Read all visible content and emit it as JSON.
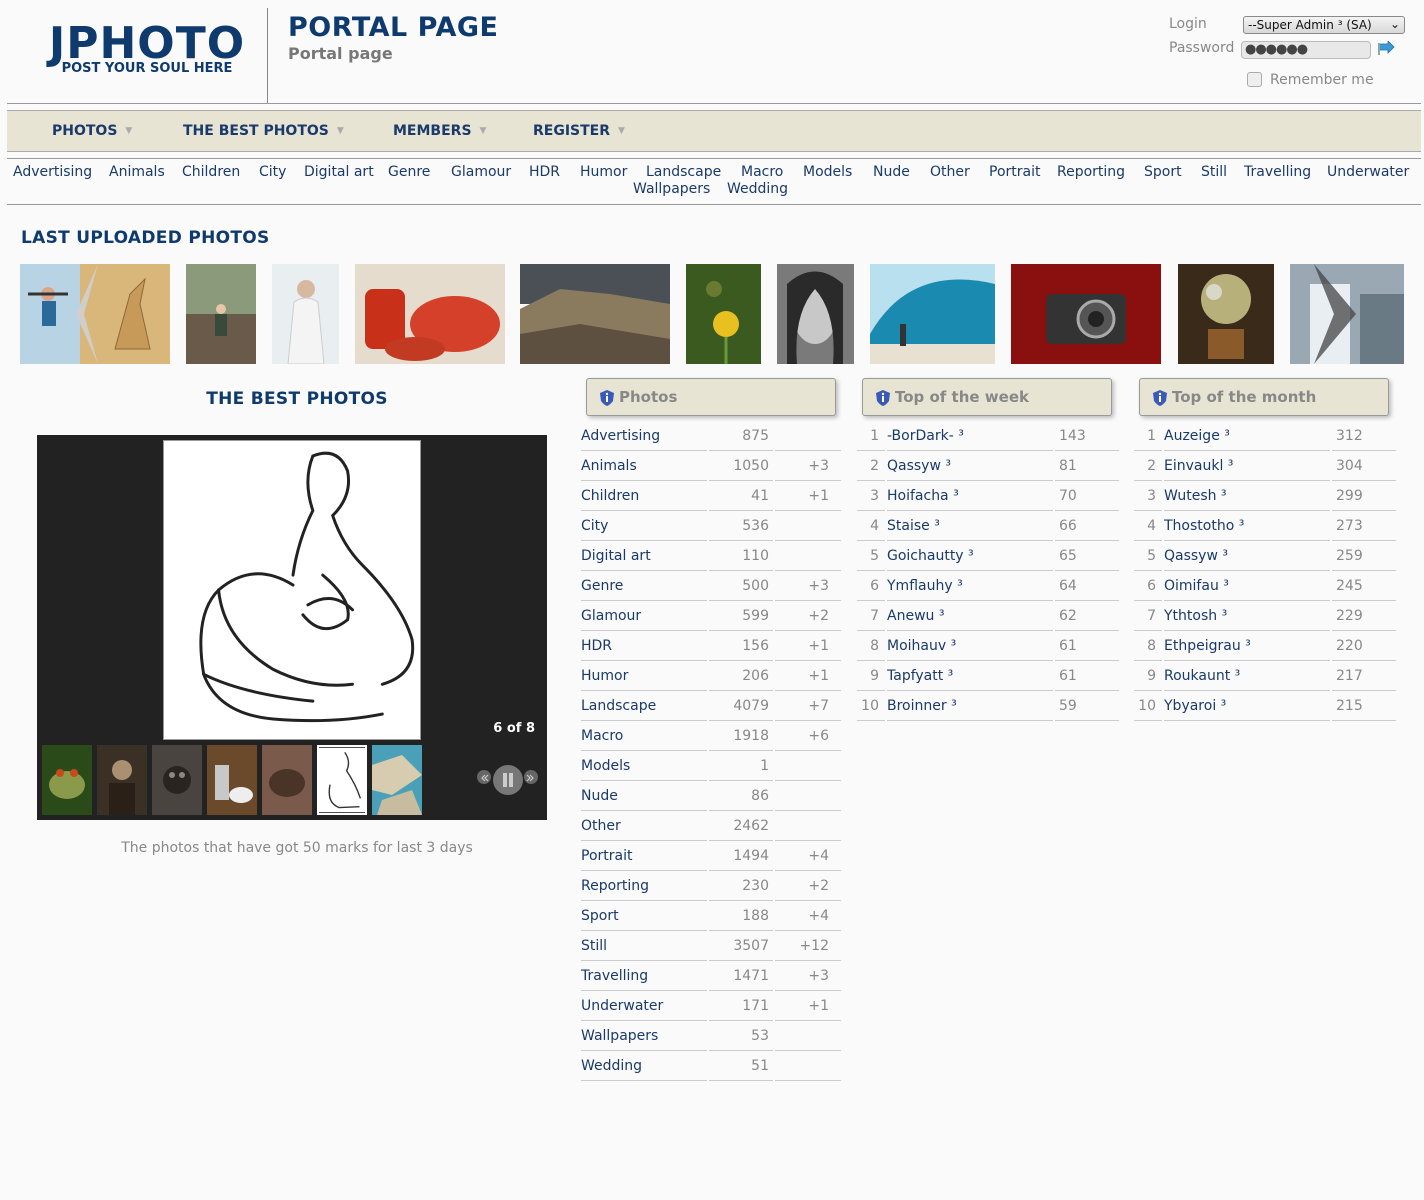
{
  "header": {
    "logo_title": "JPHOTO",
    "logo_subtitle": "POST YOUR SOUL HERE",
    "page_title": "PORTAL PAGE",
    "page_subtitle": "Portal page"
  },
  "login": {
    "login_label": "Login",
    "password_label": "Password",
    "user_select_value": "--Super Admin ³ (SA)",
    "password_value": "●●●●●●",
    "remember_label": "Remember me"
  },
  "main_nav": [
    "PHOTOS",
    "THE BEST PHOTOS",
    "MEMBERS",
    "REGISTER"
  ],
  "categories_nav": [
    "Advertising",
    "Animals",
    "Children",
    "City",
    "Digital art",
    "Genre",
    "Glamour",
    "HDR",
    "Humor",
    "Landscape",
    "Macro",
    "Models",
    "Nude",
    "Other",
    "Portrait",
    "Reporting",
    "Sport",
    "Still",
    "Travelling",
    "Underwater",
    "Wallpapers",
    "Wedding"
  ],
  "last_uploaded": {
    "title": "LAST UPLOADED PHOTOS"
  },
  "best_photos": {
    "title": "THE BEST PHOTOS",
    "counter": "6 of 8",
    "caption": "The photos that have got 50 marks for last 3 days"
  },
  "photos_panel": {
    "title": "Photos",
    "rows": [
      {
        "name": "Advertising",
        "count": "875",
        "delta": ""
      },
      {
        "name": "Animals",
        "count": "1050",
        "delta": "+3"
      },
      {
        "name": "Children",
        "count": "41",
        "delta": "+1"
      },
      {
        "name": "City",
        "count": "536",
        "delta": ""
      },
      {
        "name": "Digital art",
        "count": "110",
        "delta": ""
      },
      {
        "name": "Genre",
        "count": "500",
        "delta": "+3"
      },
      {
        "name": "Glamour",
        "count": "599",
        "delta": "+2"
      },
      {
        "name": "HDR",
        "count": "156",
        "delta": "+1"
      },
      {
        "name": "Humor",
        "count": "206",
        "delta": "+1"
      },
      {
        "name": "Landscape",
        "count": "4079",
        "delta": "+7"
      },
      {
        "name": "Macro",
        "count": "1918",
        "delta": "+6"
      },
      {
        "name": "Models",
        "count": "1",
        "delta": ""
      },
      {
        "name": "Nude",
        "count": "86",
        "delta": ""
      },
      {
        "name": "Other",
        "count": "2462",
        "delta": ""
      },
      {
        "name": "Portrait",
        "count": "1494",
        "delta": "+4"
      },
      {
        "name": "Reporting",
        "count": "230",
        "delta": "+2"
      },
      {
        "name": "Sport",
        "count": "188",
        "delta": "+4"
      },
      {
        "name": "Still",
        "count": "3507",
        "delta": "+12"
      },
      {
        "name": "Travelling",
        "count": "1471",
        "delta": "+3"
      },
      {
        "name": "Underwater",
        "count": "171",
        "delta": "+1"
      },
      {
        "name": "Wallpapers",
        "count": "53",
        "delta": ""
      },
      {
        "name": "Wedding",
        "count": "51",
        "delta": ""
      }
    ]
  },
  "week_panel": {
    "title": "Top of the week",
    "rows": [
      {
        "rank": "1",
        "name": "-BorDark- ³",
        "score": "143"
      },
      {
        "rank": "2",
        "name": "Qassyw ³",
        "score": "81"
      },
      {
        "rank": "3",
        "name": "Hoifacha ³",
        "score": "70"
      },
      {
        "rank": "4",
        "name": "Staise ³",
        "score": "66"
      },
      {
        "rank": "5",
        "name": "Goichautty ³",
        "score": "65"
      },
      {
        "rank": "6",
        "name": "Ymflauhy ³",
        "score": "64"
      },
      {
        "rank": "7",
        "name": "Anewu ³",
        "score": "62"
      },
      {
        "rank": "8",
        "name": "Moihauv ³",
        "score": "61"
      },
      {
        "rank": "9",
        "name": "Tapfyatt ³",
        "score": "61"
      },
      {
        "rank": "10",
        "name": "Broinner ³",
        "score": "59"
      }
    ]
  },
  "month_panel": {
    "title": "Top of the month",
    "rows": [
      {
        "rank": "1",
        "name": "Auzeige ³",
        "score": "312"
      },
      {
        "rank": "2",
        "name": "Einvaukl ³",
        "score": "304"
      },
      {
        "rank": "3",
        "name": "Wutesh ³",
        "score": "299"
      },
      {
        "rank": "4",
        "name": "Thostotho ³",
        "score": "273"
      },
      {
        "rank": "5",
        "name": "Qassyw ³",
        "score": "259"
      },
      {
        "rank": "6",
        "name": "Oimifau ³",
        "score": "245"
      },
      {
        "rank": "7",
        "name": "Ythtosh ³",
        "score": "229"
      },
      {
        "rank": "8",
        "name": "Ethpeigrau ³",
        "score": "220"
      },
      {
        "rank": "9",
        "name": "Roukaunt ³",
        "score": "217"
      },
      {
        "rank": "10",
        "name": "Ybyaroi ³",
        "score": "215"
      }
    ]
  },
  "colors": {
    "brand": "#0f3a6e",
    "nav_bg": "#e8e4d4",
    "link": "#1a3a6a",
    "muted": "#888888"
  },
  "icons": {
    "panel_icon": "shield-info-icon",
    "login_go": "login-arrow-icon",
    "nav_caret": "chevron-down-icon"
  }
}
